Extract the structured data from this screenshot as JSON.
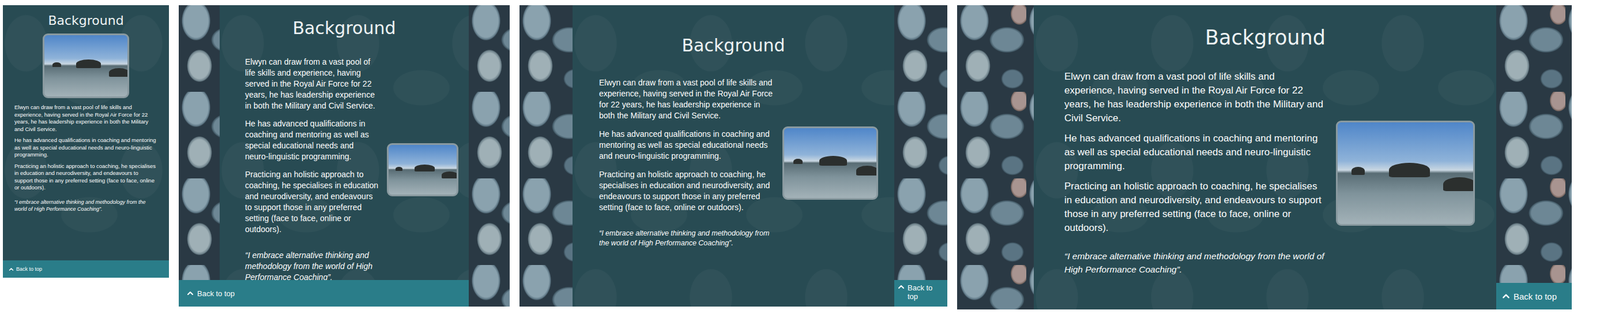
{
  "section": {
    "title": "Background",
    "paragraphs": [
      "Elwyn can draw from a vast pool of life skills and experience, having served in the Royal Air Force for 22 years, he has leadership experience in both the Military and Civil Service.",
      "He has advanced qualifications in coaching and mentoring as well as special educational needs and neuro-linguistic programming.",
      "Practicing an holistic approach to coaching, he specialises in education and neurodiversity, and endeavours to support those in any preferred setting (face to face, online or outdoors)."
    ],
    "quote": "“I embrace alternative thinking and methodology from the world of High Performance Coaching”."
  },
  "back_to_top": {
    "label": "Back to top"
  },
  "views": [
    {
      "kind": "narrow"
    },
    {
      "kind": "small"
    },
    {
      "kind": "medium"
    },
    {
      "kind": "wide"
    }
  ]
}
